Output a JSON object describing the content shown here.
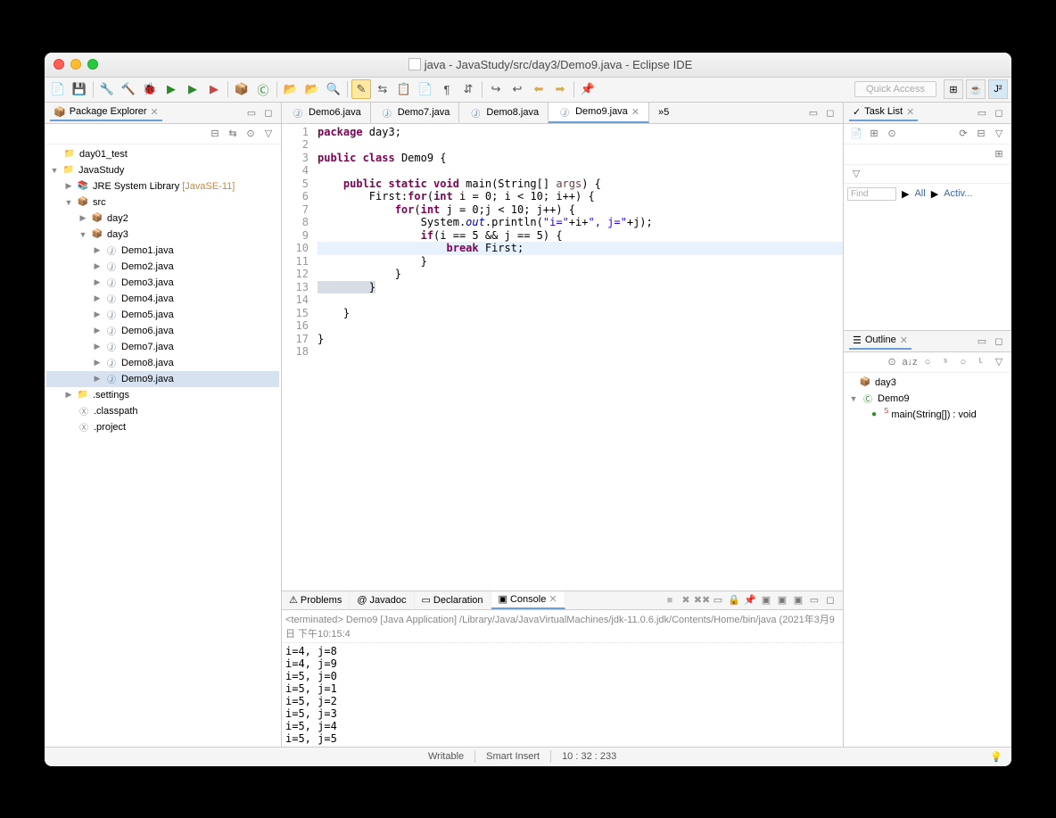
{
  "window": {
    "title": "java - JavaStudy/src/day3/Demo9.java - Eclipse IDE"
  },
  "quick_access": "Quick Access",
  "package_explorer": {
    "title": "Package Explorer"
  },
  "tree": {
    "day01_test": "day01_test",
    "java_study": "JavaStudy",
    "jre": "JRE System Library",
    "jre_note": "[JavaSE-11]",
    "src": "src",
    "day2": "day2",
    "day3": "day3",
    "demo1": "Demo1.java",
    "demo2": "Demo2.java",
    "demo3": "Demo3.java",
    "demo4": "Demo4.java",
    "demo5": "Demo5.java",
    "demo6": "Demo6.java",
    "demo7": "Demo7.java",
    "demo8": "Demo8.java",
    "demo9": "Demo9.java",
    "settings": ".settings",
    "classpath": ".classpath",
    "project": ".project"
  },
  "editor_tabs": {
    "t1": "Demo6.java",
    "t2": "Demo7.java",
    "t3": "Demo8.java",
    "t4": "Demo9.java",
    "overflow": "»5"
  },
  "code": {
    "l1a": "package",
    "l1b": " day3;",
    "l3a": "public",
    "l3b": " class",
    "l3c": " Demo9 {",
    "l5a": "    public",
    "l5b": " static",
    "l5c": " void",
    "l5d": " main(String[] ",
    "l5e": "args",
    "l5f": ") {",
    "l6a": "        First:",
    "l6b": "for",
    "l6c": "(",
    "l6d": "int",
    "l6e": " i = 0; i < 10; i++) {",
    "l7a": "            for",
    "l7b": "(",
    "l7c": "int",
    "l7d": " j = 0;j < 10; j++) {",
    "l8a": "                System.",
    "l8b": "out",
    "l8c": ".println(",
    "l8d": "\"i=\"",
    "l8e": "+i+",
    "l8f": "\", j=\"",
    "l8g": "+j);",
    "l9a": "                if",
    "l9b": "(i == 5 && j == 5) {",
    "l10a": "                    break",
    "l10b": " First;",
    "l11": "                }",
    "l12": "            }",
    "l13": "        }",
    "l15": "    }",
    "l17": "}"
  },
  "line_numbers": [
    "1",
    "2",
    "3",
    "4",
    "5",
    "6",
    "7",
    "8",
    "9",
    "10",
    "11",
    "12",
    "13",
    "14",
    "15",
    "16",
    "17",
    "18"
  ],
  "bottom_tabs": {
    "problems": "Problems",
    "javadoc": "Javadoc",
    "declaration": "Declaration",
    "console": "Console"
  },
  "console": {
    "header": "<terminated> Demo9 [Java Application] /Library/Java/JavaVirtualMachines/jdk-11.0.6.jdk/Contents/Home/bin/java (2021年3月9日 下午10:15:4",
    "lines": [
      "i=4, j=8",
      "i=4, j=9",
      "i=5, j=0",
      "i=5, j=1",
      "i=5, j=2",
      "i=5, j=3",
      "i=5, j=4",
      "i=5, j=5"
    ]
  },
  "task_list": {
    "title": "Task List",
    "find": "Find",
    "all": "All",
    "activ": "Activ..."
  },
  "outline": {
    "title": "Outline",
    "pkg": "day3",
    "cls": "Demo9",
    "method": "main(String[]) : void"
  },
  "status": {
    "writable": "Writable",
    "mode": "Smart Insert",
    "pos": "10 : 32 : 233"
  }
}
